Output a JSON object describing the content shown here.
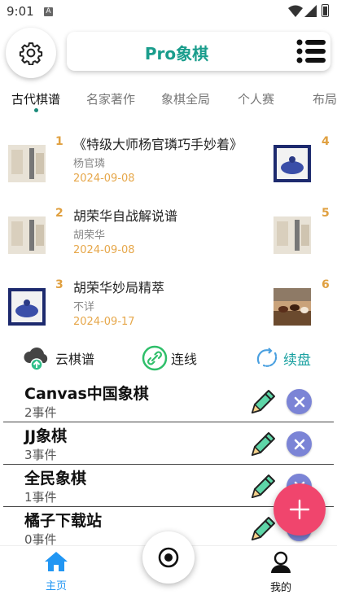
{
  "status_bar": {
    "time": "9:01",
    "notification_badge": "A"
  },
  "header": {
    "title": "Pro象棋",
    "settings_icon": "gear-icon",
    "menu_icon": "list-menu-icon"
  },
  "tabs": [
    {
      "label": "古代棋谱",
      "active": true
    },
    {
      "label": "名家著作",
      "active": false
    },
    {
      "label": "象棋全局",
      "active": false
    },
    {
      "label": "个人赛",
      "active": false
    },
    {
      "label": "布局",
      "active": false
    }
  ],
  "books": [
    {
      "num": "1",
      "title": "《特级大师杨官璘巧手妙着》",
      "author": "杨官璘",
      "date": "2024-09-08",
      "thumb": "scroll"
    },
    {
      "num": "2",
      "title": "胡荣华自战解说谱",
      "author": "胡荣华",
      "date": "2024-09-08",
      "thumb": "scroll"
    },
    {
      "num": "3",
      "title": "胡荣华妙局精萃",
      "author": "不详",
      "date": "2024-09-17",
      "thumb": "blue"
    },
    {
      "num": "4",
      "thumb": "blue"
    },
    {
      "num": "5",
      "thumb": "scroll"
    },
    {
      "num": "6",
      "thumb": "horses"
    }
  ],
  "quick_actions": [
    {
      "label": "云棋谱",
      "icon": "cloud-upload-icon"
    },
    {
      "label": "连线",
      "icon": "link-icon"
    },
    {
      "label": "续盘",
      "icon": "refresh-icon"
    }
  ],
  "events": [
    {
      "name": "Canvas中国象棋",
      "count": "2事件"
    },
    {
      "name": "JJ象棋",
      "count": "3事件"
    },
    {
      "name": "全民象棋",
      "count": "1事件"
    },
    {
      "name": "橘子下载站",
      "count": "0事件"
    }
  ],
  "bottom_nav": {
    "home": "主页",
    "mine": "我的"
  },
  "colors": {
    "accent": "#1a9d8c",
    "number": "#e0a040",
    "delete": "#7b84d6",
    "fab": "#f0456d",
    "nav_active": "#2196f3"
  }
}
